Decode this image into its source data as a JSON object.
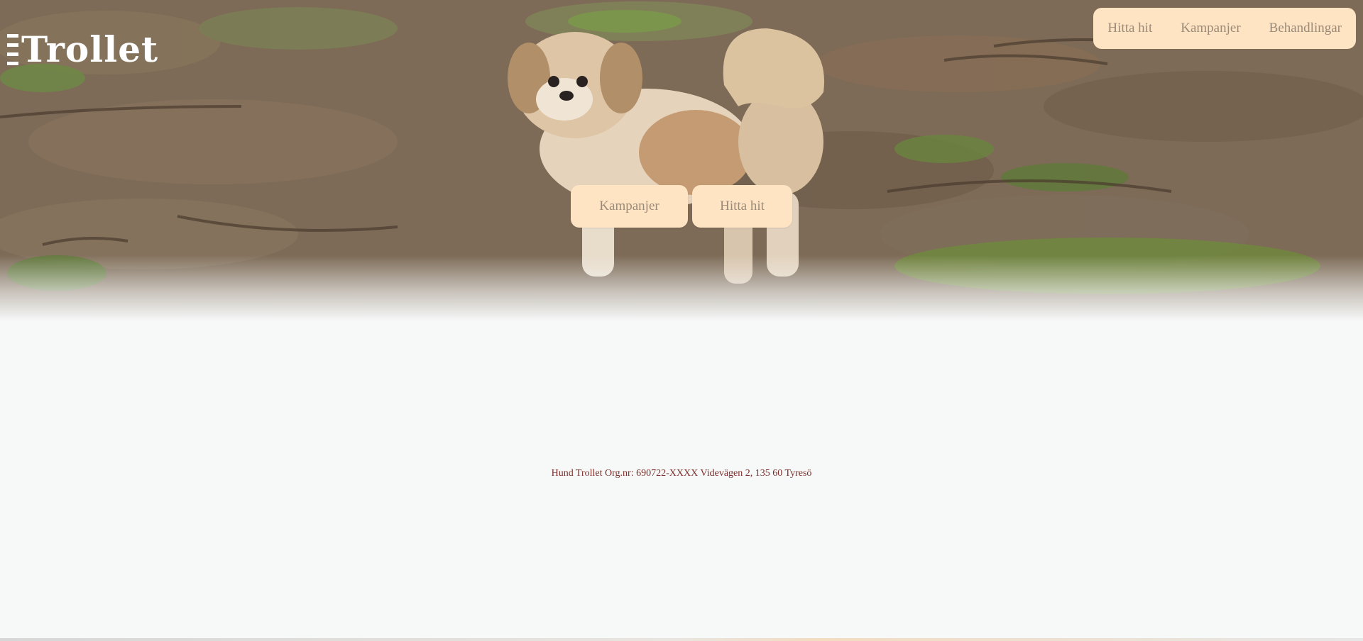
{
  "logo": {
    "text": "Trollet"
  },
  "nav": {
    "items": [
      {
        "label": "Hitta hit"
      },
      {
        "label": "Kampanjer"
      },
      {
        "label": "Behandlingar"
      }
    ]
  },
  "hero": {
    "image": "dog-in-forest-photo",
    "buttons": [
      {
        "label": "Kampanjer"
      },
      {
        "label": "Hitta hit"
      }
    ]
  },
  "footer": {
    "text": "Hund Trollet Org.nr: 690722-XXXX Videvägen 2, 135 60 Tyresö"
  },
  "colors": {
    "button_bg": "#ffe4c4",
    "button_text": "#9a8a78",
    "footer_text": "#7a2d28",
    "page_bg": "#f7f9f9"
  }
}
